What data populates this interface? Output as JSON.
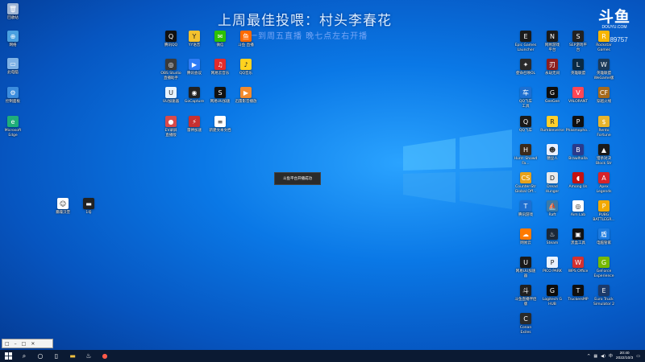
{
  "overlay": {
    "title": "上周最佳投喂：村头李春花",
    "subtitle": "周一到周五直播 晚七点左右开播"
  },
  "brand": {
    "mark": "斗鱼",
    "url": "DOUYU.COM",
    "room_id": "289757"
  },
  "toast": "斗鱼平台开播成功",
  "mini_window": {
    "controls": [
      "□",
      "–",
      "□",
      "✕"
    ]
  },
  "clock": {
    "time": "20:40",
    "date": "2022/10/3"
  },
  "icons_left": [
    {
      "label": "回收站",
      "name": "recycle-bin-icon",
      "color": "#9fb6d6",
      "glyph": "🗑"
    },
    {
      "label": "网络",
      "name": "network-icon",
      "color": "#4aa0e0",
      "glyph": "⊕"
    },
    {
      "label": "此电脑",
      "name": "this-pc-icon",
      "color": "#7fb2e6",
      "glyph": "▭"
    },
    {
      "label": "控制面板",
      "name": "control-panel-icon",
      "color": "#3c8dde",
      "glyph": "⚙"
    },
    {
      "label": "Microsoft\nEdge",
      "name": "edge-icon",
      "color": "#1fae7a",
      "glyph": "e"
    },
    {
      "label": "暴躁汉堡",
      "name": "app-icon-a",
      "color": "#ffffff",
      "glyph": "☺"
    },
    {
      "label": "1号",
      "name": "app-icon-b",
      "color": "#222222",
      "glyph": "▬"
    }
  ],
  "icons_mid": [
    {
      "label": "腾讯QQ",
      "name": "qq-icon",
      "color": "#111111",
      "glyph": "Q"
    },
    {
      "label": "YY语音",
      "name": "yy-icon",
      "color": "#f2c12e",
      "glyph": "Y"
    },
    {
      "label": "微信",
      "name": "wechat-icon",
      "color": "#2dc100",
      "glyph": "✉"
    },
    {
      "label": "斗鱼 直播",
      "name": "douyu-app-icon",
      "color": "#ff6a00",
      "glyph": "鱼"
    },
    {
      "label": "OBS Studio\n直播助手",
      "name": "obs-icon",
      "color": "#3b3b3b",
      "glyph": "◎"
    },
    {
      "label": "腾讯会议",
      "name": "meeting-icon",
      "color": "#2e7cf6",
      "glyph": "▶"
    },
    {
      "label": "网易云音乐",
      "name": "netease-music-icon",
      "color": "#e22b2b",
      "glyph": "♫"
    },
    {
      "label": "QQ音乐",
      "name": "qq-music-icon",
      "color": "#ffd21f",
      "glyph": "♪"
    },
    {
      "label": "UU加速器",
      "name": "uu-icon",
      "color": "#e8f4ff",
      "glyph": "U"
    },
    {
      "label": "GoCapture",
      "name": "capture-icon",
      "color": "#222222",
      "glyph": "◉"
    },
    {
      "label": "网易UU加速",
      "name": "uu-booster-icon",
      "color": "#111111",
      "glyph": "S"
    },
    {
      "label": "迅雷影音播放",
      "name": "player-icon",
      "color": "#f28b2e",
      "glyph": "▶"
    },
    {
      "label": "EV录屏\n直播版",
      "name": "ev-icon",
      "color": "#d84a4a",
      "glyph": "●"
    },
    {
      "label": "雷神加速",
      "name": "leishen-icon",
      "color": "#c83030",
      "glyph": "⚡"
    },
    {
      "label": "新建文本文档",
      "name": "text-doc-icon",
      "color": "#ffffff",
      "glyph": "≡"
    }
  ],
  "icons_right": [
    {
      "label": "Epic Games\nLauncher",
      "name": "epic-icon",
      "color": "#1a1a1a",
      "glyph": "E"
    },
    {
      "label": "网易游戏\n平台",
      "name": "netease-games-icon",
      "color": "#1a1a1a",
      "glyph": "N"
    },
    {
      "label": "SEP游戏平\n台",
      "name": "sep-icon",
      "color": "#222222",
      "glyph": "S"
    },
    {
      "label": "Rockstar\nGames",
      "name": "rockstar-icon",
      "color": "#f7b500",
      "glyph": "R"
    },
    {
      "label": "使命召唤OL",
      "name": "cod-icon",
      "color": "#2a2a2a",
      "glyph": "✦"
    },
    {
      "label": "永劫无间",
      "name": "naraka-icon",
      "color": "#8c1e1e",
      "glyph": "刃"
    },
    {
      "label": "英雄联盟",
      "name": "lol-icon",
      "color": "#0a2a44",
      "glyph": "L"
    },
    {
      "label": "英雄联盟\nWeGame版",
      "name": "lol-wegame-icon",
      "color": "#1b3a5a",
      "glyph": "W"
    },
    {
      "label": "QQ飞车\n工具",
      "name": "qqspeed-icon",
      "color": "#1d6fd1",
      "glyph": "车"
    },
    {
      "label": "GeeGee",
      "name": "geegee-icon",
      "color": "#0e0e0e",
      "glyph": "G"
    },
    {
      "label": "VALORANT",
      "name": "valorant-icon",
      "color": "#ff4655",
      "glyph": "V"
    },
    {
      "label": "穿越火线",
      "name": "cf-icon",
      "color": "#a66a1c",
      "glyph": "CF"
    },
    {
      "label": "QQ飞车",
      "name": "qqcar-icon",
      "color": "#1a1a1a",
      "glyph": "Q"
    },
    {
      "label": "Rumbleverse",
      "name": "rumble-icon",
      "color": "#ffcf2a",
      "glyph": "R"
    },
    {
      "label": "Phasmopho...",
      "name": "phasmo-icon",
      "color": "#101010",
      "glyph": "P"
    },
    {
      "label": "Rento\nFortune",
      "name": "rento-icon",
      "color": "#e7b42b",
      "glyph": "$"
    },
    {
      "label": "Hunt: Showd\nFa...",
      "name": "hunt-icon",
      "color": "#3b2a1a",
      "glyph": "H"
    },
    {
      "label": "糖豆人",
      "name": "fallguys-icon",
      "color": "#e9f0ff",
      "glyph": "☻"
    },
    {
      "label": "Brawlhalla",
      "name": "brawlhalla-icon",
      "color": "#2a3b8c",
      "glyph": "B"
    },
    {
      "label": "猎杀对决\nBlock Str",
      "name": "blockstrike-icon",
      "color": "#1a1a1a",
      "glyph": "▲"
    },
    {
      "label": "Counter-Str\nGlobal Off...",
      "name": "csgo-icon",
      "color": "#e8a21a",
      "glyph": "CS"
    },
    {
      "label": "Dread\nHunger",
      "name": "dread-icon",
      "color": "#eaeaea",
      "glyph": "D"
    },
    {
      "label": "Among Us",
      "name": "amongus-icon",
      "color": "#c51111",
      "glyph": "◖"
    },
    {
      "label": "Apex\nLegends",
      "name": "apex-icon",
      "color": "#d8232a",
      "glyph": "A"
    },
    {
      "label": "腾讯游戏",
      "name": "tencent-games-icon",
      "color": "#1d6fd1",
      "glyph": "T"
    },
    {
      "label": "Raft",
      "name": "raft-icon",
      "color": "#3b7aa8",
      "glyph": "⛵"
    },
    {
      "label": "Aim Lab",
      "name": "aimlab-icon",
      "color": "#ffffff",
      "glyph": "◎"
    },
    {
      "label": "PUBG\nBATTLEGR...",
      "name": "pubg-icon",
      "color": "#f2a900",
      "glyph": "P"
    },
    {
      "label": "网易云",
      "name": "netease-cloud-icon",
      "color": "#ff7a00",
      "glyph": "☁"
    },
    {
      "label": "Steam",
      "name": "steam-icon",
      "color": "#1b2838",
      "glyph": "♨"
    },
    {
      "label": "黑盒工具",
      "name": "heybox-icon",
      "color": "#111111",
      "glyph": "▣"
    },
    {
      "label": "电脑管家",
      "name": "pc-manager-icon",
      "color": "#1c7be0",
      "glyph": "盾"
    },
    {
      "label": "网易UU加速\n器",
      "name": "netease-uu-icon",
      "color": "#1a1a1a",
      "glyph": "U"
    },
    {
      "label": "PICO PARK",
      "name": "picopark-icon",
      "color": "#e9f2ff",
      "glyph": "P"
    },
    {
      "label": "WPS Office",
      "name": "wps-icon",
      "color": "#d53030",
      "glyph": "W"
    },
    {
      "label": "GeForce\nExperience",
      "name": "geforce-icon",
      "color": "#76b900",
      "glyph": "G"
    },
    {
      "label": "斗鱼直播伴侣\n版",
      "name": "douyu-companion-icon",
      "color": "#202020",
      "glyph": "斗"
    },
    {
      "label": "Logitech G\nHUB",
      "name": "ghub-icon",
      "color": "#0b0b0b",
      "glyph": "G"
    },
    {
      "label": "TruckersMP",
      "name": "truckersmp-icon",
      "color": "#0e0e0e",
      "glyph": "T"
    },
    {
      "label": "Euro Truck\nSimulator 2",
      "name": "ets2-icon",
      "color": "#1c3a6a",
      "glyph": "E"
    },
    {
      "label": "Conan\nExiles",
      "name": "conan-icon",
      "color": "#2a2a2a",
      "glyph": "C"
    }
  ]
}
